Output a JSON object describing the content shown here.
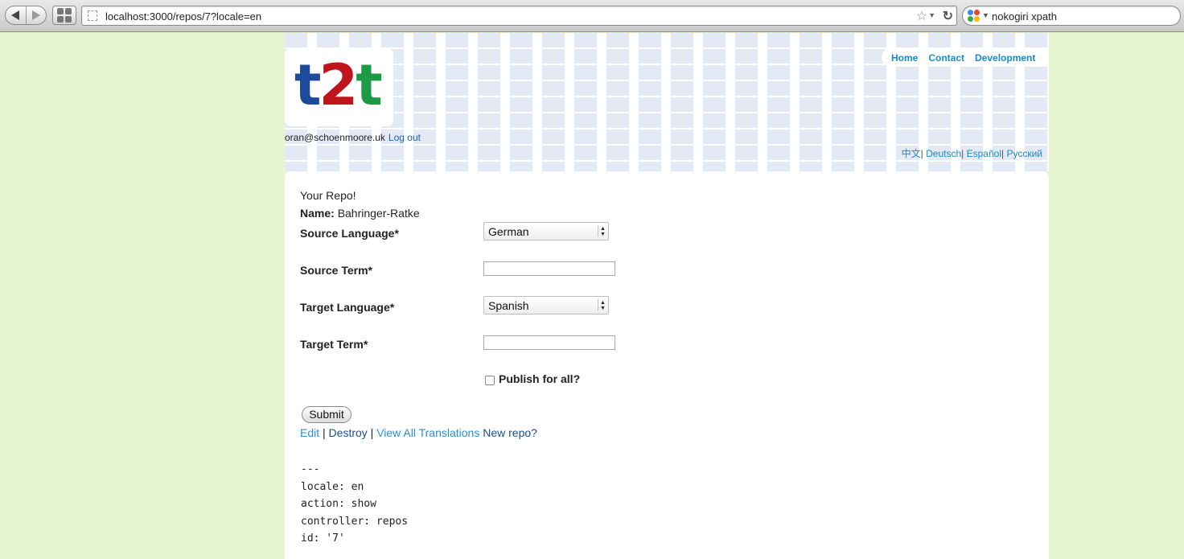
{
  "browser": {
    "url": "localhost:3000/repos/7?locale=en",
    "search_query": "nokogiri xpath"
  },
  "header": {
    "logo": {
      "t1": "t",
      "digit": "2",
      "t2": "t"
    },
    "user_email": "oran@schoenmoore.uk",
    "logout_label": "Log out",
    "nav": [
      {
        "label": "Home"
      },
      {
        "label": "Contact"
      },
      {
        "label": "Development"
      }
    ],
    "languages": [
      {
        "label": "中文"
      },
      {
        "label": "Deutsch"
      },
      {
        "label": "Español"
      },
      {
        "label": "Русский"
      }
    ],
    "language_separator": "|"
  },
  "repo": {
    "heading": "Your Repo!",
    "name_label": "Name:",
    "name_value": "Bahringer-Ratke",
    "source_language_label": "Source Language*",
    "source_language_value": "German",
    "source_term_label": "Source Term*",
    "source_term_value": "",
    "target_language_label": "Target Language*",
    "target_language_value": "Spanish",
    "target_term_label": "Target Term*",
    "target_term_value": "",
    "publish_label": "Publish for all?",
    "publish_checked": false,
    "submit_label": "Submit"
  },
  "actions": {
    "edit": "Edit",
    "destroy": "Destroy",
    "view_all": "View All Translations",
    "new_repo": "New repo?",
    "separator": "|"
  },
  "debug_lines": [
    "---",
    "locale: en",
    "action: show",
    "controller: repos",
    "id: '7'"
  ],
  "colors": {
    "background": "#e6f5d0",
    "link_blue": "#1a8ac8",
    "logo_blue": "#1d4a9a",
    "logo_red": "#c0141d",
    "logo_green": "#1c9a44"
  }
}
